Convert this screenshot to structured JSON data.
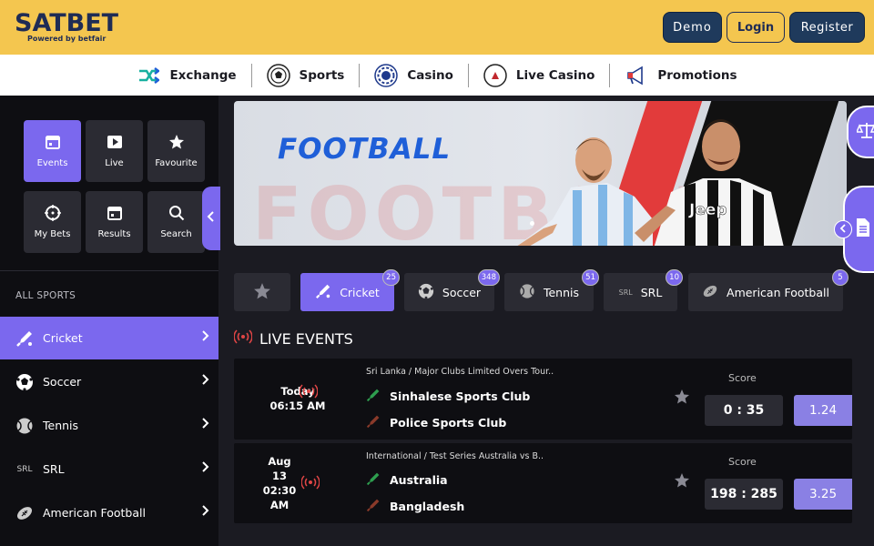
{
  "header": {
    "logo": "SATBET",
    "logo_sub": "Powered by betfair",
    "demo": "Demo",
    "login": "Login",
    "register": "Register"
  },
  "nav": [
    {
      "label": "Exchange",
      "icon": "exchange-arrows-icon"
    },
    {
      "label": "Sports",
      "icon": "soccer-ball-icon"
    },
    {
      "label": "Casino",
      "icon": "casino-chip-icon"
    },
    {
      "label": "Live Casino",
      "icon": "roulette-icon"
    },
    {
      "label": "Promotions",
      "icon": "megaphone-icon"
    }
  ],
  "sidebar": {
    "tiles": [
      {
        "label": "Events",
        "icon": "calendar-icon",
        "active": true
      },
      {
        "label": "Live",
        "icon": "play-icon"
      },
      {
        "label": "Favourite",
        "icon": "star-icon"
      },
      {
        "label": "My Bets",
        "icon": "target-icon"
      },
      {
        "label": "Results",
        "icon": "calendar-check-icon"
      },
      {
        "label": "Search",
        "icon": "search-icon"
      }
    ],
    "all_sports_label": "ALL SPORTS",
    "sports": [
      {
        "label": "Cricket",
        "icon": "cricket-bat-icon",
        "active": true
      },
      {
        "label": "Soccer",
        "icon": "soccer-ball-icon"
      },
      {
        "label": "Tennis",
        "icon": "tennis-ball-icon"
      },
      {
        "label": "SRL",
        "icon": "srl-text-icon",
        "icon_text": "SRL"
      },
      {
        "label": "American Football",
        "icon": "american-football-icon"
      }
    ]
  },
  "banner": {
    "title": "FOOTBALL",
    "bg_text": "FOOTBALL"
  },
  "sport_tabs": [
    {
      "label": "Cricket",
      "count": "25",
      "active": true
    },
    {
      "label": "Soccer",
      "count": "348"
    },
    {
      "label": "Tennis",
      "count": "51"
    },
    {
      "label": "SRL",
      "count": "10",
      "icon_text": "SRL"
    },
    {
      "label": "American Football",
      "count": "5"
    }
  ],
  "live_events": {
    "heading": "LIVE EVENTS",
    "score_label": "Score",
    "events": [
      {
        "time_line1": "Today",
        "time_line2": "06:15 AM",
        "competition": "Sri Lanka / Major Clubs Limited Overs Tour..",
        "team1": "Sinhalese Sports Club",
        "team2": "Police Sports Club",
        "score": "0 : 35",
        "odds": "1.24"
      },
      {
        "time_line1": "Aug",
        "time_line2": "13",
        "time_line3": "02:30",
        "time_line4": "AM",
        "competition": "International / Test Series Australia vs B..",
        "team1": "Australia",
        "team2": "Bangladesh",
        "score": "198 : 285",
        "odds": "3.25"
      }
    ]
  },
  "colors": {
    "header_bg": "#f4c64f",
    "accent": "#7b68ee",
    "dark_bg": "#0e0e12",
    "panel_bg": "#2b2b33",
    "live_red": "#e04545"
  }
}
